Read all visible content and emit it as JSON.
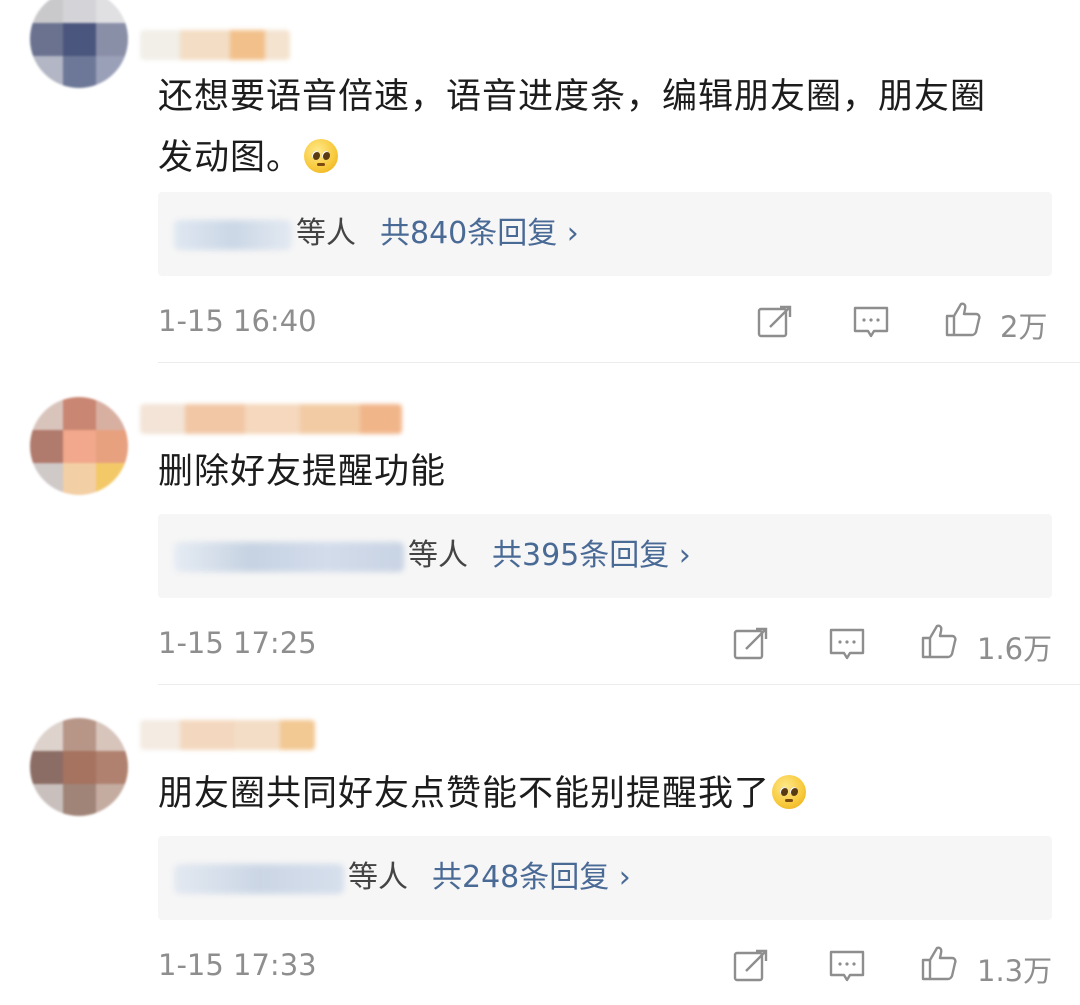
{
  "comments": [
    {
      "text_line1": "还想要语音倍速，语音进度条，编辑朋友圈，朋友圈",
      "text_line2": "发动图。",
      "emoji": "pleading-face-emoji",
      "reply_suffix": "等人",
      "reply_count": "共840条回复 ›",
      "time": "1-15 16:40",
      "likes": "2万"
    },
    {
      "text_line1": "删除好友提醒功能",
      "reply_suffix": "等人",
      "reply_count": "共395条回复 ›",
      "time": "1-15 17:25",
      "likes": "1.6万"
    },
    {
      "text_line1": "朋友圈共同好友点赞能不能别提醒我了",
      "emoji": "zipper-mouth-emoji",
      "reply_suffix": "等人",
      "reply_count": "共248条回复 ›",
      "time": "1-15 17:33",
      "likes": "1.3万"
    }
  ],
  "colors": {
    "link": "#4a6a96",
    "meta": "#8e8e8e",
    "reply_bg": "#f6f6f6"
  }
}
